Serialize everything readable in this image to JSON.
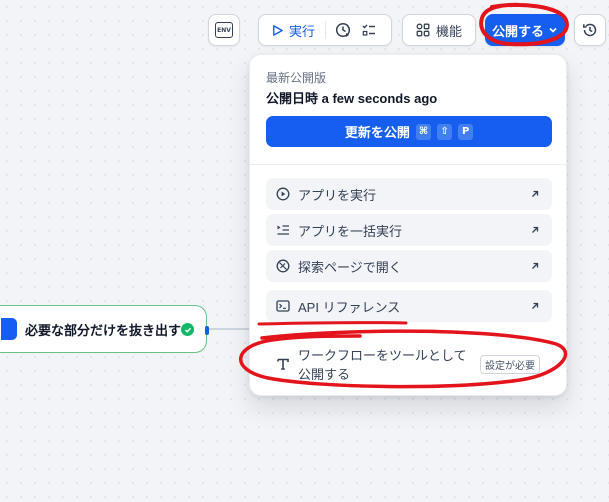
{
  "toolbar": {
    "env_label": "ENV",
    "run_label": "実行",
    "features_label": "機能",
    "publish_label": "公開する"
  },
  "publish_menu": {
    "section_label": "最新公開版",
    "published_at": "公開日時 a few seconds ago",
    "update_button": {
      "label": "更新を公開",
      "shortcut": [
        "⌘",
        "⇧",
        "P"
      ]
    },
    "items": [
      {
        "label": "アプリを実行",
        "icon": "play-circle-icon"
      },
      {
        "label": "アプリを一括実行",
        "icon": "batch-run-icon"
      },
      {
        "label": "探索ページで開く",
        "icon": "compass-icon"
      },
      {
        "label": "API リファレンス",
        "icon": "terminal-icon"
      }
    ],
    "tool_item": {
      "label": "ワークフローをツールとして公開する",
      "badge": "設定が必要",
      "icon": "tool-icon"
    }
  },
  "canvas": {
    "node_label": "必要な部分だけを抜き出す"
  },
  "colors": {
    "accent": "#155eef",
    "success": "#12b76a",
    "annotation": "#e3141b"
  }
}
